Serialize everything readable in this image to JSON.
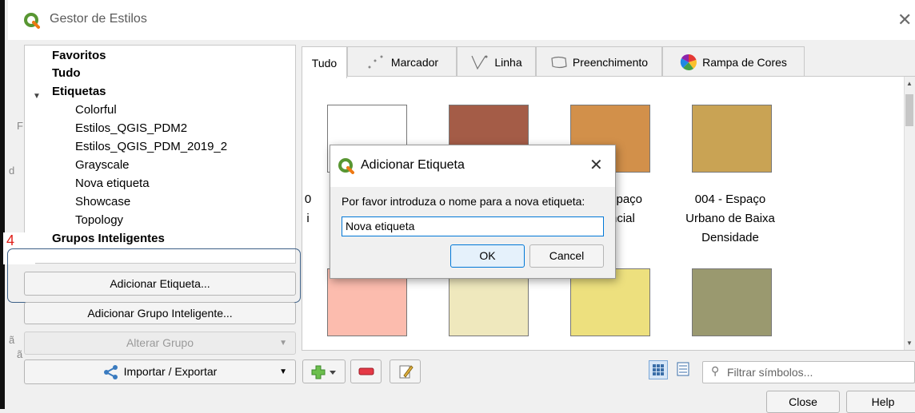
{
  "window": {
    "title": "Gestor de Estilos",
    "close_glyph": "✕"
  },
  "stray_chars": [
    "F",
    "d",
    "ã",
    "ã"
  ],
  "tree": {
    "items": [
      {
        "label": "Favoritos",
        "bold": true
      },
      {
        "label": "Tudo",
        "bold": true
      },
      {
        "label": "Etiquetas",
        "bold": true,
        "expanded": true
      },
      {
        "label": "Colorful",
        "bold": false
      },
      {
        "label": "Estilos_QGIS_PDM2",
        "bold": false
      },
      {
        "label": "Estilos_QGIS_PDM_2019_2",
        "bold": false
      },
      {
        "label": "Grayscale",
        "bold": false
      },
      {
        "label": "Nova etiqueta",
        "bold": false
      },
      {
        "label": "Showcase",
        "bold": false
      },
      {
        "label": "Topology",
        "bold": false
      },
      {
        "label": "Grupos Inteligentes",
        "bold": true
      }
    ]
  },
  "annotation": {
    "number": "4",
    "color": "#e0201a"
  },
  "left_buttons": {
    "add_tag": "Adicionar Etiqueta...",
    "add_smart_group": "Adicionar Grupo Inteligente...",
    "modify_group": "Alterar Grupo",
    "import_export": "Importar / Exportar"
  },
  "tabs": [
    {
      "label": "Tudo",
      "icon": "none",
      "active": true
    },
    {
      "label": "Marcador",
      "icon": "marker-dots-icon"
    },
    {
      "label": "Linha",
      "icon": "line-icon"
    },
    {
      "label": "Preenchimento",
      "icon": "fill-icon"
    },
    {
      "label": "Rampa de Cores",
      "icon": "color-ramp-icon"
    }
  ],
  "symbols": [
    {
      "color": "#ffffff",
      "label": "0\ni"
    },
    {
      "color": "#a45c47",
      "label": ""
    },
    {
      "color": "#d2904a",
      "label": "spaço\nncial"
    },
    {
      "color": "#c9a354",
      "label": "004 - Espaço\nUrbano de Baixa\nDensidade"
    },
    {
      "color": "#fcbcae",
      "label": ""
    },
    {
      "color": "#efe8bd",
      "label": ""
    },
    {
      "color": "#ede07e",
      "label": ""
    },
    {
      "color": "#9a996f",
      "label": ""
    }
  ],
  "dialog": {
    "title": "Adicionar Etiqueta",
    "prompt": "Por favor introduza o nome para a nova etiqueta:",
    "input_value": "Nova etiqueta",
    "ok": "OK",
    "cancel": "Cancel"
  },
  "search": {
    "placeholder": "Filtrar símbolos..."
  },
  "bottom": {
    "close": "Close",
    "help": "Help"
  }
}
